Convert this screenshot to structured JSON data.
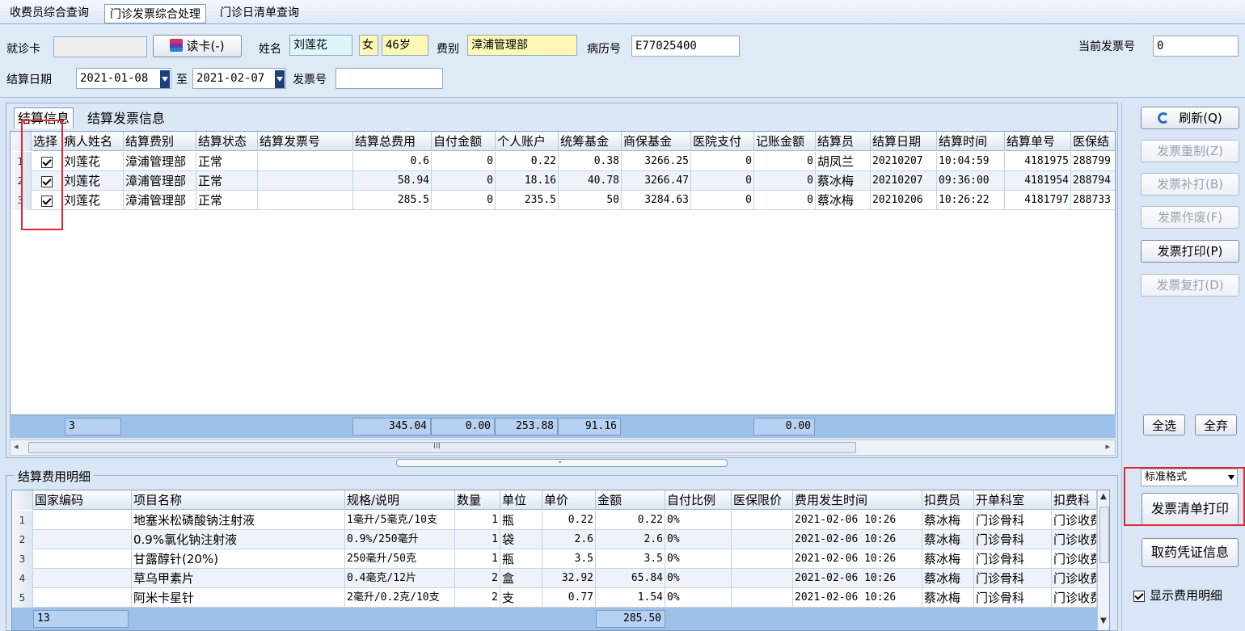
{
  "tabs": [
    "收费员综合查询",
    "门诊发票综合处理",
    "门诊日清单查询"
  ],
  "top": {
    "card_label": "就诊卡",
    "card_value": "",
    "read_card_button": "读卡(-)",
    "name_label": "姓名",
    "name_value": "刘莲花",
    "gender_value": "女",
    "age_value": "46岁",
    "fee_type_label": "费别",
    "fee_type_value": "漳浦管理部",
    "record_label": "病历号",
    "record_value": "E77025400",
    "current_invoice_label": "当前发票号",
    "current_invoice_value": "0",
    "settle_date_label": "结算日期",
    "date_from": "2021-01-08",
    "to_label": "至",
    "date_to": "2021-02-07",
    "invoice_no_label": "发票号",
    "invoice_no_value": ""
  },
  "settle_tabs": [
    "结算信息",
    "结算发票信息"
  ],
  "settle_grid": {
    "headers": [
      "选择",
      "病人姓名",
      "结算费别",
      "结算状态",
      "结算发票号",
      "结算总费用",
      "自付金额",
      "个人账户",
      "统筹基金",
      "商保基金",
      "医院支付",
      "记账金额",
      "结算员",
      "结算日期",
      "结算时间",
      "结算单号",
      "医保结"
    ],
    "rows": [
      {
        "no": "1",
        "checked": true,
        "name": "刘莲花",
        "fee_type": "漳浦管理部",
        "status": "正常",
        "invoice": "",
        "total": "0.6",
        "self_pay": "0",
        "personal": "0.22",
        "fund": "0.38",
        "commercial": "3266.25",
        "hospital": "0",
        "account": "0",
        "operator": "胡凤兰",
        "date": "20210207",
        "time": "10:04:59",
        "bill_no": "4181975",
        "ins": "288799"
      },
      {
        "no": "2",
        "checked": true,
        "name": "刘莲花",
        "fee_type": "漳浦管理部",
        "status": "正常",
        "invoice": "",
        "total": "58.94",
        "self_pay": "0",
        "personal": "18.16",
        "fund": "40.78",
        "commercial": "3266.47",
        "hospital": "0",
        "account": "0",
        "operator": "蔡冰梅",
        "date": "20210207",
        "time": "09:36:00",
        "bill_no": "4181954",
        "ins": "288794"
      },
      {
        "no": "3",
        "checked": true,
        "name": "刘莲花",
        "fee_type": "漳浦管理部",
        "status": "正常",
        "invoice": "",
        "total": "285.5",
        "self_pay": "0",
        "personal": "235.5",
        "fund": "50",
        "commercial": "3284.63",
        "hospital": "0",
        "account": "0",
        "operator": "蔡冰梅",
        "date": "20210206",
        "time": "10:26:22",
        "bill_no": "4181797",
        "ins": "288733"
      }
    ],
    "footer": {
      "count": "3",
      "total": "345.04",
      "self_pay": "0.00",
      "personal": "253.88",
      "fund": "91.16",
      "account": "0.00"
    }
  },
  "scroll_marker": "III",
  "detail": {
    "title": "结算费用明细",
    "headers": [
      "国家编码",
      "项目名称",
      "规格/说明",
      "数量",
      "单位",
      "单价",
      "金额",
      "自付比例",
      "医保限价",
      "费用发生时间",
      "扣费员",
      "开单科室",
      "扣费科"
    ],
    "rows": [
      {
        "no": "1",
        "code": "",
        "item": "地塞米松磷酸钠注射液",
        "spec": "1毫升/5毫克/10支",
        "qty": "1",
        "unit": "瓶",
        "price": "0.22",
        "amount": "0.22",
        "ratio": "0%",
        "limit": "",
        "time": "2021-02-06 10:26",
        "operator": "蔡冰梅",
        "dept": "门诊骨科",
        "charge_dept": "门诊收费"
      },
      {
        "no": "2",
        "code": "",
        "item": "0.9%氯化钠注射液",
        "spec": "0.9%/250毫升",
        "qty": "1",
        "unit": "袋",
        "price": "2.6",
        "amount": "2.6",
        "ratio": "0%",
        "limit": "",
        "time": "2021-02-06 10:26",
        "operator": "蔡冰梅",
        "dept": "门诊骨科",
        "charge_dept": "门诊收费"
      },
      {
        "no": "3",
        "code": "",
        "item": "甘露醇针(20%)",
        "spec": "250毫升/50克",
        "qty": "1",
        "unit": "瓶",
        "price": "3.5",
        "amount": "3.5",
        "ratio": "0%",
        "limit": "",
        "time": "2021-02-06 10:26",
        "operator": "蔡冰梅",
        "dept": "门诊骨科",
        "charge_dept": "门诊收费"
      },
      {
        "no": "4",
        "code": "",
        "item": "草乌甲素片",
        "spec": "0.4毫克/12片",
        "qty": "2",
        "unit": "盒",
        "price": "32.92",
        "amount": "65.84",
        "ratio": "0%",
        "limit": "",
        "time": "2021-02-06 10:26",
        "operator": "蔡冰梅",
        "dept": "门诊骨科",
        "charge_dept": "门诊收费"
      },
      {
        "no": "5",
        "code": "",
        "item": "阿米卡星针",
        "spec": "2毫升/0.2克/10支",
        "qty": "2",
        "unit": "支",
        "price": "0.77",
        "amount": "1.54",
        "ratio": "0%",
        "limit": "",
        "time": "2021-02-06 10:26",
        "operator": "蔡冰梅",
        "dept": "门诊骨科",
        "charge_dept": "门诊收费"
      }
    ],
    "footer": {
      "count": "13",
      "amount": "285.50"
    }
  },
  "side": {
    "refresh": "刷新(Q)",
    "reissue": "发票重制(Z)",
    "reprint_b": "发票补打(B)",
    "void": "发票作废(F)",
    "print": "发票打印(P)",
    "reprint_d": "发票复打(D)",
    "select_all": "全选",
    "select_none": "全弃",
    "format": "标准格式",
    "list_print": "发票清单打印",
    "drug_voucher": "取药凭证信息",
    "show_detail": "显示费用明细",
    "show_detail_checked": true
  },
  "colors": {
    "selection_outline": "#e0272d",
    "grid_footer": "#9ec1ea",
    "name_field": "#dcf6fa",
    "highlight_field": "#fdf8b6"
  }
}
